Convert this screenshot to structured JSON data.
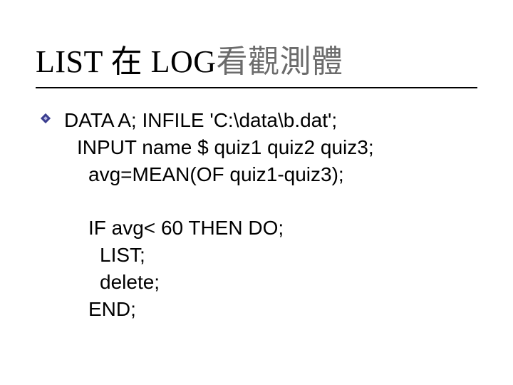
{
  "title": {
    "parts": [
      {
        "text": "LIST ",
        "cls": ""
      },
      {
        "text": "在",
        "cls": ""
      },
      {
        "text": " LOG",
        "cls": ""
      },
      {
        "text": "看觀測體",
        "cls": "gray"
      }
    ]
  },
  "code": {
    "l1": "DATA A; INFILE 'C:\\data\\b.dat';",
    "l2": "INPUT name $ quiz1 quiz2 quiz3;",
    "l3": "avg=MEAN(OF quiz1-quiz3);",
    "l4": "IF avg< 60 THEN DO;",
    "l5": "LIST;",
    "l6": "delete;",
    "l7": "END;"
  }
}
